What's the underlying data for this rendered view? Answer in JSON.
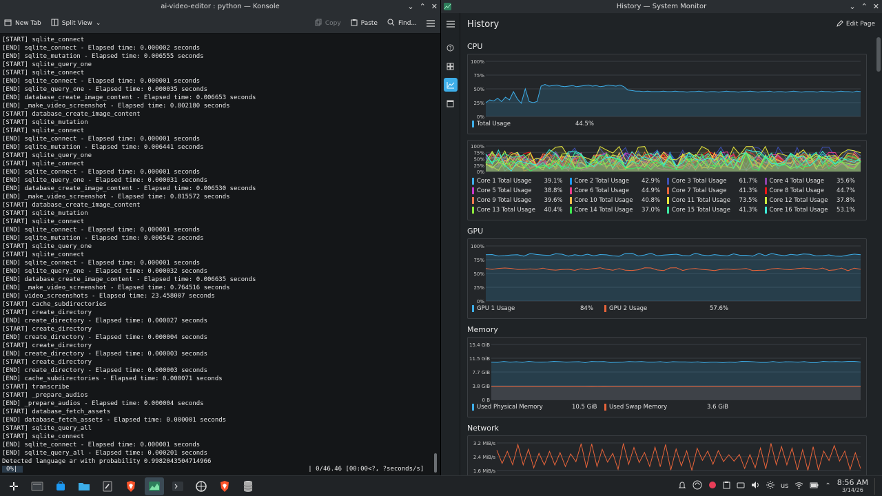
{
  "konsole": {
    "title": "ai-video-editor : python — Konsole",
    "toolbar": {
      "new_tab": "New Tab",
      "split_view": "Split View",
      "copy": "Copy",
      "paste": "Paste",
      "find": "Find..."
    },
    "lines": [
      "[START] sqlite_connect",
      "[END] sqlite_connect - Elapsed time: 0.000002 seconds",
      "[END] sqlite_mutation - Elapsed time: 0.006555 seconds",
      "[START] sqlite_query_one",
      "[START] sqlite_connect",
      "[END] sqlite_connect - Elapsed time: 0.000001 seconds",
      "[END] sqlite_query_one - Elapsed time: 0.000035 seconds",
      "[END] database_create_image_content - Elapsed time: 0.006653 seconds",
      "[END] _make_video_screenshot - Elapsed time: 0.802180 seconds",
      "[START] database_create_image_content",
      "[START] sqlite_mutation",
      "[START] sqlite_connect",
      "[END] sqlite_connect - Elapsed time: 0.000001 seconds",
      "[END] sqlite_mutation - Elapsed time: 0.006441 seconds",
      "[START] sqlite_query_one",
      "[START] sqlite_connect",
      "[END] sqlite_connect - Elapsed time: 0.000001 seconds",
      "[END] sqlite_query_one - Elapsed time: 0.000031 seconds",
      "[END] database_create_image_content - Elapsed time: 0.006530 seconds",
      "[END] _make_video_screenshot - Elapsed time: 0.815572 seconds",
      "[START] database_create_image_content",
      "[START] sqlite_mutation",
      "[START] sqlite_connect",
      "[END] sqlite_connect - Elapsed time: 0.000001 seconds",
      "[END] sqlite_mutation - Elapsed time: 0.006542 seconds",
      "[START] sqlite_query_one",
      "[START] sqlite_connect",
      "[END] sqlite_connect - Elapsed time: 0.000001 seconds",
      "[END] sqlite_query_one - Elapsed time: 0.000032 seconds",
      "[END] database_create_image_content - Elapsed time: 0.006635 seconds",
      "[END] _make_video_screenshot - Elapsed time: 0.764516 seconds",
      "[END] video_screenshots - Elapsed time: 23.458007 seconds",
      "[START] cache_subdirectories",
      "[START] create_directory",
      "[END] create_directory - Elapsed time: 0.000027 seconds",
      "[START] create_directory",
      "[END] create_directory - Elapsed time: 0.000004 seconds",
      "[START] create_directory",
      "[END] create_directory - Elapsed time: 0.000003 seconds",
      "[START] create_directory",
      "[END] create_directory - Elapsed time: 0.000003 seconds",
      "[END] cache_subdirectories - Elapsed time: 0.000071 seconds",
      "[START] transcribe",
      "[START] _prepare_audios",
      "[END] _prepare_audios - Elapsed time: 0.000004 seconds",
      "[START] database_fetch_assets",
      "[END] database_fetch_assets - Elapsed time: 0.000001 seconds",
      "[START] sqlite_query_all",
      "[START] sqlite_connect",
      "[END] sqlite_connect - Elapsed time: 0.000001 seconds",
      "[END] sqlite_query_all - Elapsed time: 0.000201 seconds",
      "Detected language ar with probability 0.9982043504714966"
    ],
    "progress_pct": "0%|",
    "progress_rest": "| 0/46.46 [00:00<?, ?seconds/s]"
  },
  "sysmon": {
    "title": "History — System Monitor",
    "page_title": "History",
    "edit_page": "Edit Page",
    "sidebar_icons": [
      "help-icon",
      "overview-icon",
      "history-icon",
      "applications-icon"
    ],
    "sections": {
      "cpu": "CPU",
      "gpu": "GPU",
      "memory": "Memory",
      "network": "Network"
    },
    "cpu_total": {
      "y_ticks": [
        "100%",
        "75%",
        "50%",
        "25%",
        "0%"
      ],
      "label": "Total Usage",
      "value": "44.5%",
      "color": "#3daee9",
      "series": [
        25,
        30,
        28,
        33,
        27,
        35,
        30,
        45,
        32,
        24,
        50,
        27,
        25,
        27,
        55,
        58,
        55,
        56,
        57,
        55,
        54,
        55,
        56,
        54,
        55,
        56,
        57,
        55,
        56,
        54,
        55,
        57,
        56,
        55,
        57,
        54,
        48,
        47,
        46,
        46,
        45,
        46,
        45,
        45,
        45,
        46,
        45,
        45,
        46,
        45,
        45,
        44,
        45,
        45,
        46,
        45,
        44,
        45,
        45,
        44,
        45,
        46,
        45,
        45,
        44,
        45,
        45,
        46,
        45,
        44,
        45,
        45,
        46,
        44,
        45,
        45,
        44,
        45,
        46,
        45,
        44,
        45,
        45,
        45,
        44,
        46,
        45,
        45,
        44,
        45,
        46,
        45,
        45,
        44,
        46,
        45
      ]
    },
    "cpu_cores": {
      "y_ticks": [
        "100%",
        "75%",
        "50%",
        "25%",
        "0%"
      ],
      "cores": [
        {
          "label": "Core 1 Total Usage",
          "value": "39.1%",
          "color": "#3daee9"
        },
        {
          "label": "Core 2 Total Usage",
          "value": "42.9%",
          "color": "#1d99f3"
        },
        {
          "label": "Core 3 Total Usage",
          "value": "61.7%",
          "color": "#3f51b5"
        },
        {
          "label": "Core 4 Total Usage",
          "value": "35.6%",
          "color": "#8e44ad"
        },
        {
          "label": "Core 5 Total Usage",
          "value": "38.8%",
          "color": "#c837c8"
        },
        {
          "label": "Core 6 Total Usage",
          "value": "44.9%",
          "color": "#e93d8c"
        },
        {
          "label": "Core 7 Total Usage",
          "value": "41.3%",
          "color": "#e9643a"
        },
        {
          "label": "Core 8 Total Usage",
          "value": "44.7%",
          "color": "#ed1515"
        },
        {
          "label": "Core 9 Total Usage",
          "value": "39.6%",
          "color": "#f47750"
        },
        {
          "label": "Core 10 Total Usage",
          "value": "40.8%",
          "color": "#fdbc4b"
        },
        {
          "label": "Core 11 Total Usage",
          "value": "73.5%",
          "color": "#e9e93d"
        },
        {
          "label": "Core 12 Total Usage",
          "value": "37.8%",
          "color": "#c9e93d"
        },
        {
          "label": "Core 13 Total Usage",
          "value": "40.4%",
          "color": "#8ee93d"
        },
        {
          "label": "Core 14 Total Usage",
          "value": "37.0%",
          "color": "#3de94f"
        },
        {
          "label": "Core 15 Total Usage",
          "value": "41.3%",
          "color": "#3de9a2"
        },
        {
          "label": "Core 16 Total Usage",
          "value": "53.1%",
          "color": "#3de9d8"
        }
      ]
    },
    "gpu": {
      "y_ticks": [
        "100%",
        "75%",
        "50%",
        "25%",
        "0%"
      ],
      "series": [
        {
          "label": "GPU 1 Usage",
          "value": "84%",
          "color": "#3daee9",
          "level": 84
        },
        {
          "label": "GPU 2 Usage",
          "value": "57.6%",
          "color": "#e9643a",
          "level": 57.6
        }
      ]
    },
    "memory": {
      "y_ticks": [
        "15.4 GiB",
        "11.5 GiB",
        "7.7 GiB",
        "3.8 GiB",
        "0 B"
      ],
      "series": [
        {
          "label": "Used Physical Memory",
          "value": "10.5 GiB",
          "color": "#3daee9",
          "level": 10.5
        },
        {
          "label": "Used Swap Memory",
          "value": "3.6 GiB",
          "color": "#e9643a",
          "level": 3.6
        }
      ]
    },
    "network": {
      "y_ticks": [
        "3.2 MiB/s",
        "2.4 MiB/s",
        "1.6 MiB/s"
      ]
    }
  },
  "taskbar": {
    "apps": [
      "application-launcher-icon",
      "terminal-icon",
      "store-icon",
      "files-icon",
      "text-editor-icon",
      "brave-icon",
      "system-monitor-icon",
      "console-icon",
      "app-icon",
      "brave-icon",
      "database-icon"
    ],
    "tray": {
      "keyboard_layout": "us",
      "time": "8:56 AM",
      "date": "3/14/26"
    }
  }
}
